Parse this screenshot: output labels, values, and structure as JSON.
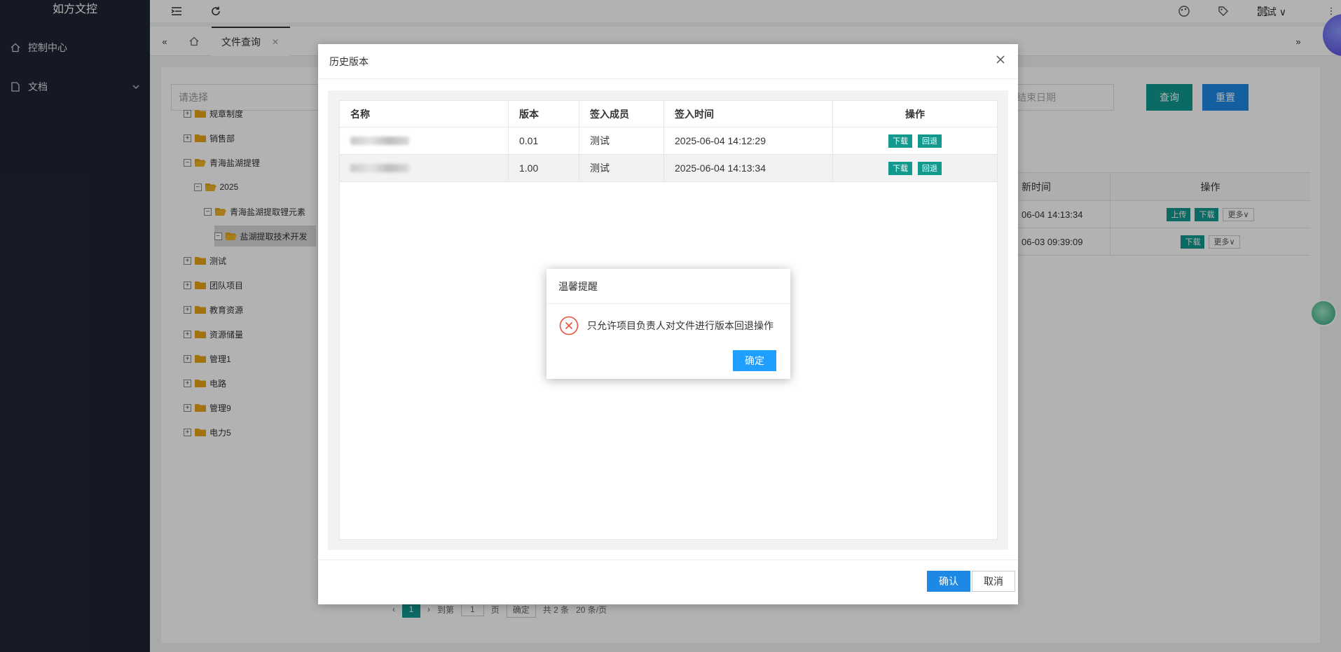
{
  "app": {
    "brand": "如方文控"
  },
  "sidebar": {
    "items": [
      {
        "label": "控制中心",
        "icon": "home-icon"
      },
      {
        "label": "文档",
        "icon": "document-icon"
      }
    ]
  },
  "topbar": {
    "user": "测试"
  },
  "tabs": {
    "active_label": "文件查询"
  },
  "search": {
    "tree_placeholder": "请选择",
    "date_placeholder": "结束日期",
    "query_label": "查询",
    "reset_label": "重置"
  },
  "tree": [
    {
      "label": "规章制度",
      "level": 0,
      "expanded": false
    },
    {
      "label": "销售部",
      "level": 0,
      "expanded": false
    },
    {
      "label": "青海盐湖提锂",
      "level": 0,
      "expanded": true
    },
    {
      "label": "2025",
      "level": 1,
      "expanded": true
    },
    {
      "label": "青海盐湖提取锂元素",
      "level": 2,
      "expanded": true
    },
    {
      "label": "盐湖提取技术开发",
      "level": 3,
      "expanded": true,
      "selected": true
    },
    {
      "label": "测试",
      "level": 0,
      "expanded": false
    },
    {
      "label": "团队项目",
      "level": 0,
      "expanded": false
    },
    {
      "label": "教育资源",
      "level": 0,
      "expanded": false
    },
    {
      "label": "资源储量",
      "level": 0,
      "expanded": false
    },
    {
      "label": "管理1",
      "level": 0,
      "expanded": false
    },
    {
      "label": "电路",
      "level": 0,
      "expanded": false
    },
    {
      "label": "管理9",
      "level": 0,
      "expanded": false
    },
    {
      "label": "电力5",
      "level": 0,
      "expanded": false
    }
  ],
  "background_table": {
    "headers": [
      "新时间",
      "操作"
    ],
    "rows": [
      {
        "time": "06-04 14:13:34",
        "actions": [
          "上传",
          "下载"
        ],
        "more": "更多"
      },
      {
        "time": "06-03 09:39:09",
        "actions": [
          "下载"
        ],
        "more": "更多"
      }
    ]
  },
  "pager": {
    "current": "1",
    "goto_label": "到第",
    "page_value": "1",
    "page_unit": "页",
    "confirm": "确定",
    "total": "共 2 条",
    "page_size": "20 条/页"
  },
  "history_modal": {
    "title": "历史版本",
    "headers": [
      "名称",
      "版本",
      "签入成员",
      "签入时间",
      "操作"
    ],
    "rows": [
      {
        "version": "0.01",
        "member": "测试",
        "time": "2025-06-04 14:12:29",
        "actions": [
          "下载",
          "回退"
        ]
      },
      {
        "version": "1.00",
        "member": "测试",
        "time": "2025-06-04 14:13:34",
        "actions": [
          "下载",
          "回退"
        ]
      }
    ],
    "confirm_label": "确认",
    "cancel_label": "取消"
  },
  "alert": {
    "title": "温馨提醒",
    "message": "只允许项目负责人对文件进行版本回退操作",
    "button": "确定"
  },
  "colors": {
    "sidebar": "#1f2533",
    "primary": "#1e88e5",
    "teal": "#11998e",
    "error": "#e8543c",
    "alert_button": "#1e9fff"
  }
}
